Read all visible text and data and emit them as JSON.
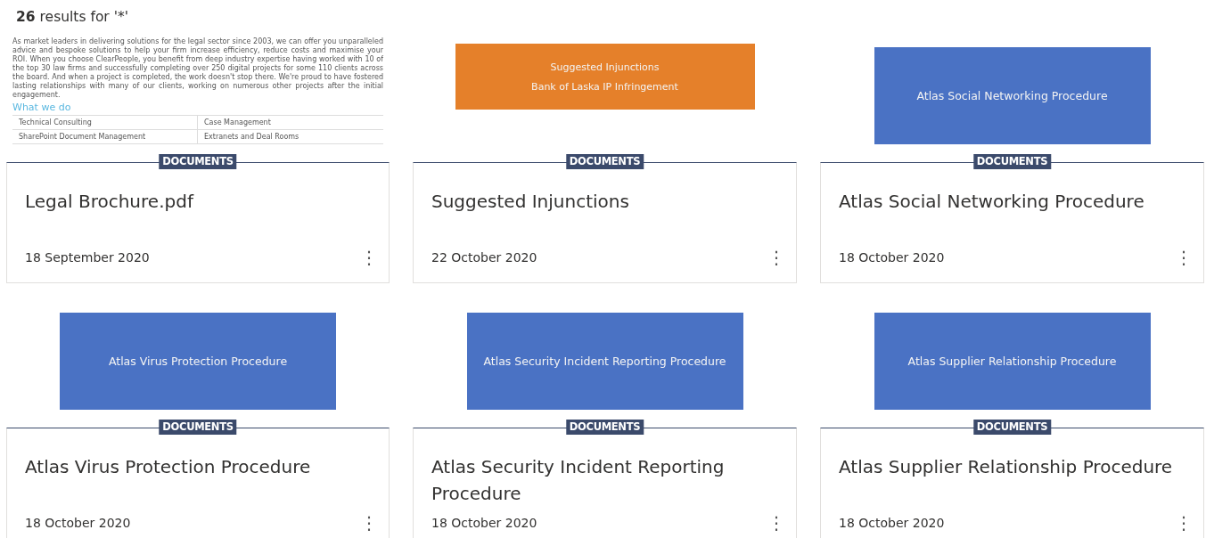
{
  "header": {
    "count": "26",
    "text": "results for '*'"
  },
  "results": [
    {
      "thumbnail": {
        "kind": "document",
        "paragraph": "As market leaders in delivering solutions for the legal sector since 2003, we can offer you unparalleled advice and bespoke solutions to help your firm increase efficiency, reduce costs and maximise your ROI. When you choose ClearPeople, you benefit from deep industry expertise having worked with 10 of the top 30 law firms and successfully completing over 250 digital projects for some 110 clients across the board. And when a project is completed, the work doesn't stop there. We're proud to have fostered lasting relationships with many of our clients, working on numerous other projects after the initial engagement.",
        "heading": "What we do",
        "table": [
          [
            "Technical Consulting",
            "Case Management"
          ],
          [
            "SharePoint Document Management",
            "Extranets and Deal Rooms"
          ]
        ]
      },
      "tag": "DOCUMENTS",
      "title": "Legal Brochure.pdf",
      "date": "18 September 2020",
      "menu": "⋮"
    },
    {
      "thumbnail": {
        "kind": "tile",
        "color": "#e5802a",
        "lines": [
          "Suggested Injunctions",
          "Bank of Laska IP Infringement"
        ]
      },
      "tag": "DOCUMENTS",
      "title": "Suggested Injunctions",
      "date": "22 October 2020",
      "menu": "⋮"
    },
    {
      "thumbnail": {
        "kind": "tile",
        "color": "#4a72c4",
        "lines": [
          "Atlas Social Networking Procedure"
        ]
      },
      "tag": "DOCUMENTS",
      "title": "Atlas Social Networking Procedure",
      "date": "18 October 2020",
      "menu": "⋮"
    },
    {
      "thumbnail": {
        "kind": "tile",
        "color": "#4a72c4",
        "lines": [
          "Atlas Virus Protection Procedure"
        ]
      },
      "tag": "DOCUMENTS",
      "title": "Atlas Virus Protection Procedure",
      "date": "18 October 2020",
      "menu": "⋮"
    },
    {
      "thumbnail": {
        "kind": "tile",
        "color": "#4a72c4",
        "lines": [
          "Atlas Security Incident Reporting Procedure"
        ]
      },
      "tag": "DOCUMENTS",
      "title": "Atlas Security Incident Reporting Procedure",
      "date": "18 October 2020",
      "menu": "⋮"
    },
    {
      "thumbnail": {
        "kind": "tile",
        "color": "#4a72c4",
        "lines": [
          "Atlas Supplier Relationship Procedure"
        ]
      },
      "tag": "DOCUMENTS",
      "title": "Atlas Supplier Relationship Procedure",
      "date": "18 October 2020",
      "menu": "⋮"
    }
  ]
}
